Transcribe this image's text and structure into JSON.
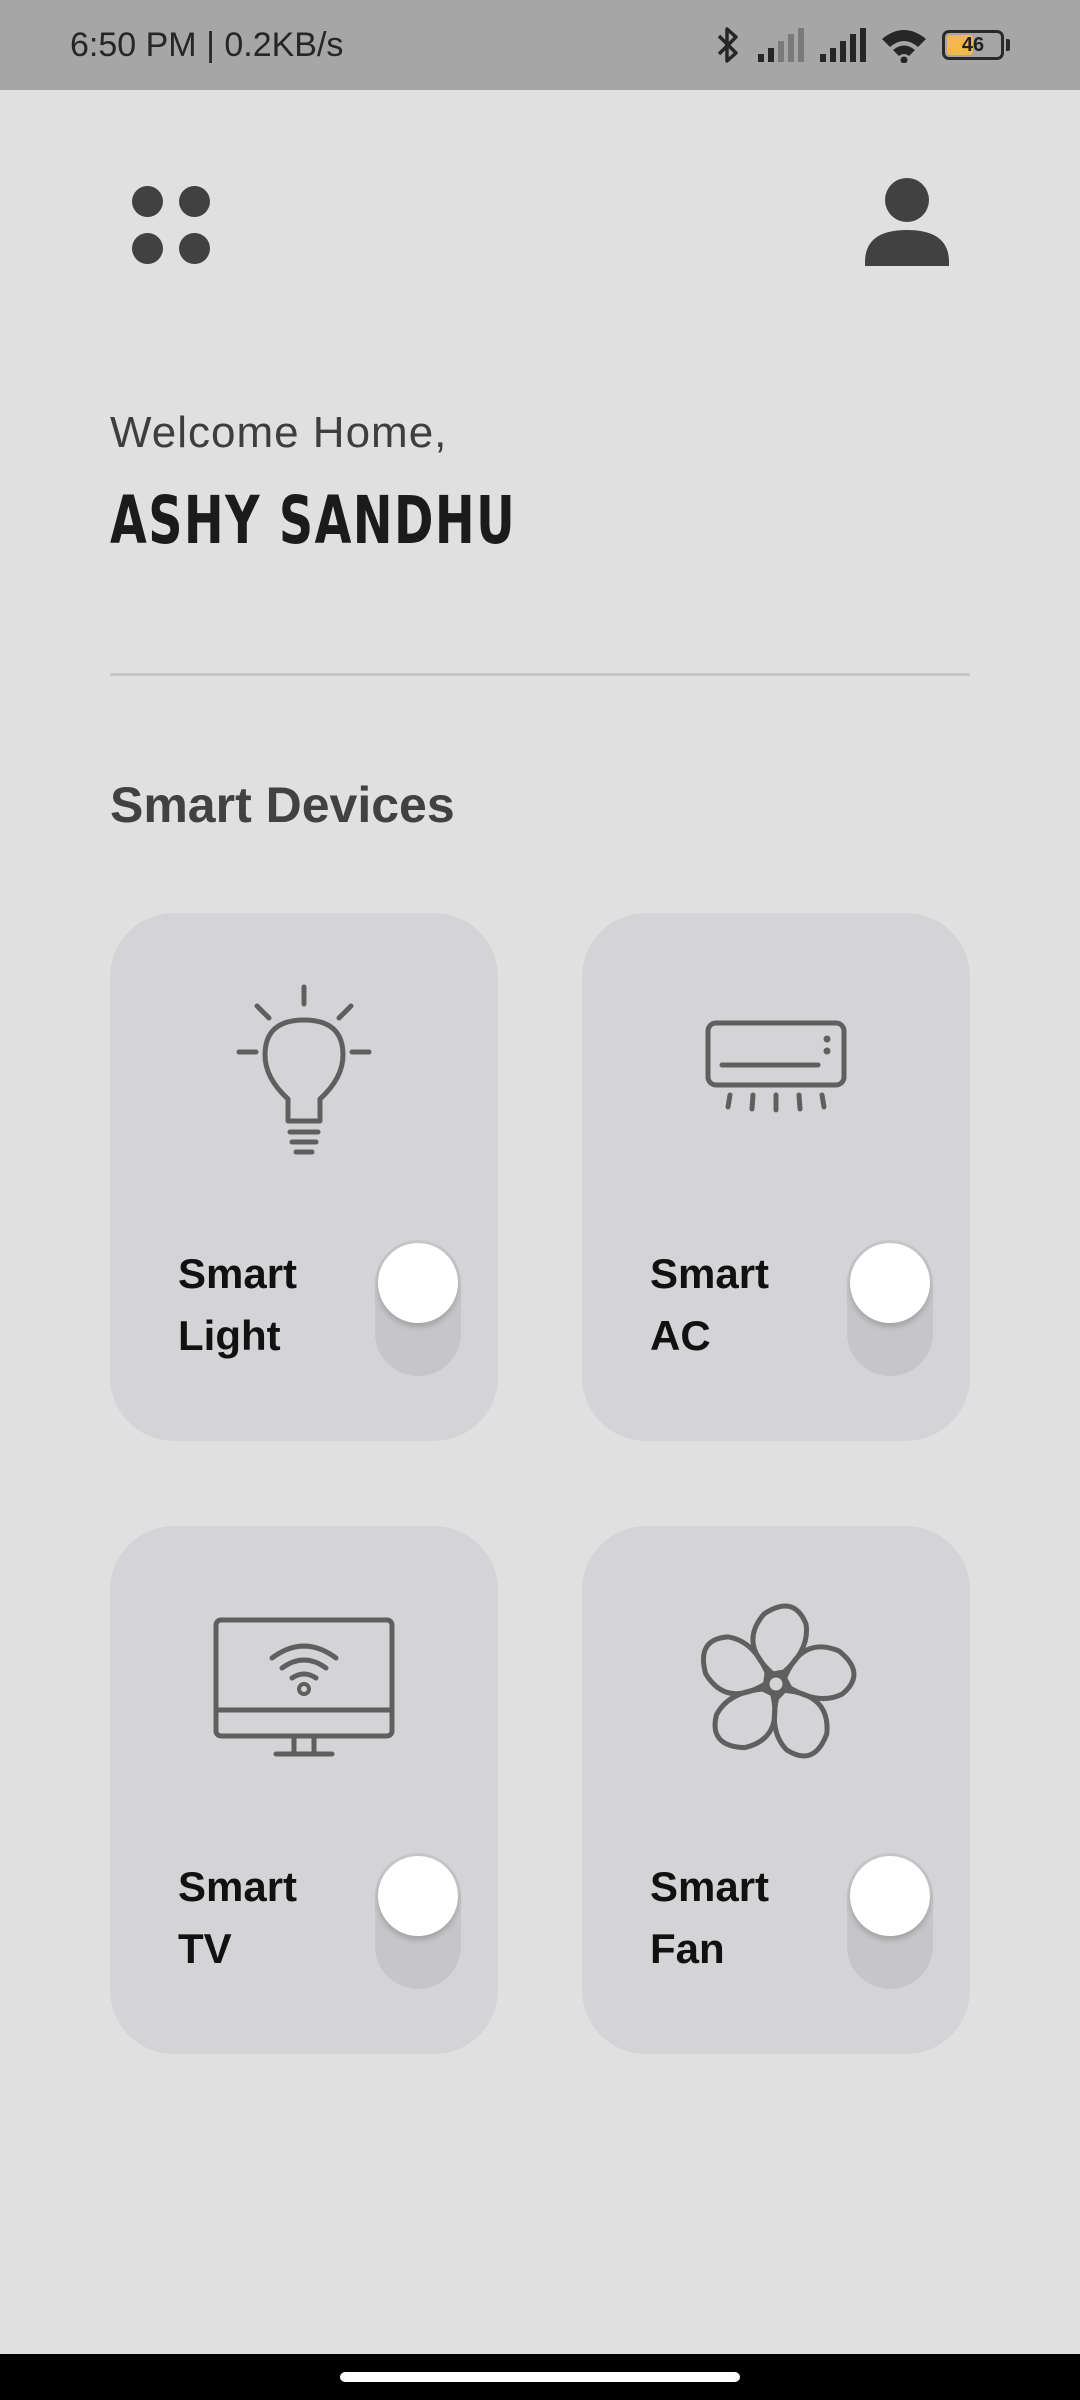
{
  "status_bar": {
    "time_speed": "6:50 PM | 0.2KB/s",
    "battery_level": "46",
    "icons": [
      "bluetooth-icon",
      "signal-weak-icon",
      "signal-strong-icon",
      "wifi-icon",
      "battery-icon"
    ]
  },
  "header": {
    "menu_icon": "grid-dots-icon",
    "profile_icon": "user-icon"
  },
  "welcome": {
    "greeting": "Welcome Home,",
    "name": "ASHY SANDHU"
  },
  "section": {
    "title": "Smart Devices"
  },
  "devices": [
    {
      "label_line1": "Smart",
      "label_line2": "Light",
      "icon": "lightbulb-icon",
      "on": false
    },
    {
      "label_line1": "Smart",
      "label_line2": "AC",
      "icon": "air-conditioner-icon",
      "on": false
    },
    {
      "label_line1": "Smart",
      "label_line2": "TV",
      "icon": "smart-tv-icon",
      "on": false
    },
    {
      "label_line1": "Smart",
      "label_line2": "Fan",
      "icon": "fan-icon",
      "on": false
    }
  ],
  "colors": {
    "background": "#e0e0e0",
    "status_bar": "#a6a6a6",
    "card": "#d4d4d7",
    "icon": "#5f5f5f",
    "text_dark": "#111111",
    "battery_fill": "#f2b84b"
  }
}
